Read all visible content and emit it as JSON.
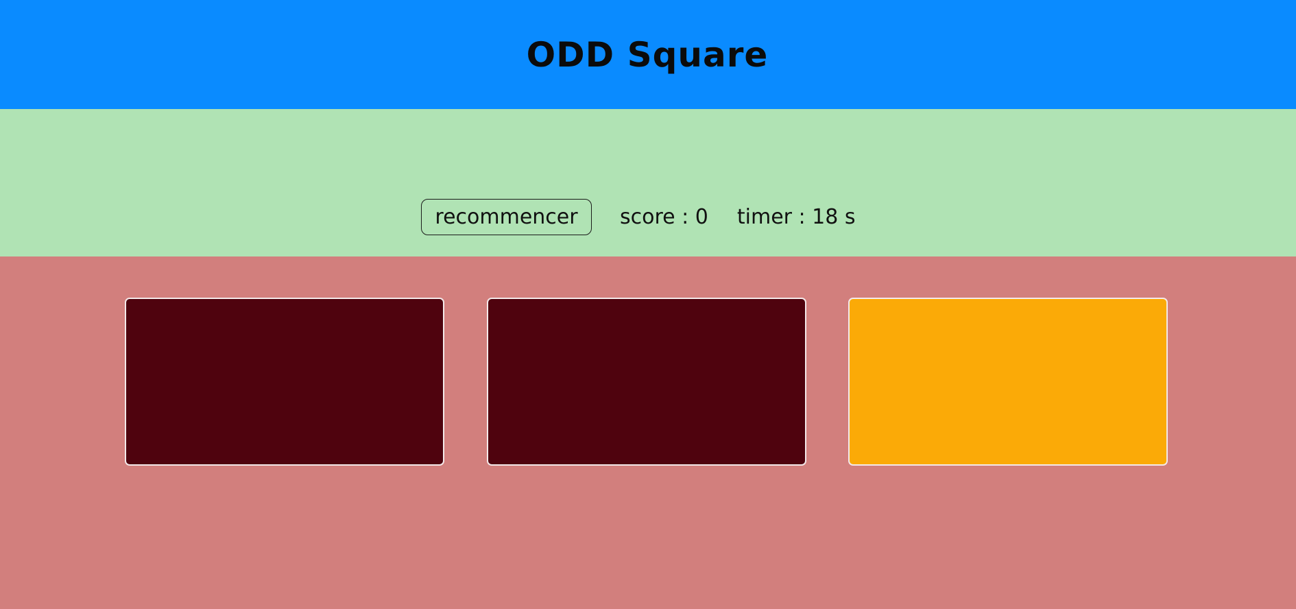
{
  "header": {
    "title": "ODD Square",
    "background": "#0a8bff"
  },
  "controls": {
    "restart_label": "recommencer",
    "score_text": "score : 0",
    "timer_text": "timer : 18 s",
    "background": "#b0e3b4"
  },
  "board": {
    "background": "#d27f7d",
    "squares": [
      {
        "color": "#4f030e"
      },
      {
        "color": "#4f030e"
      },
      {
        "color": "#fbaa07"
      }
    ]
  }
}
